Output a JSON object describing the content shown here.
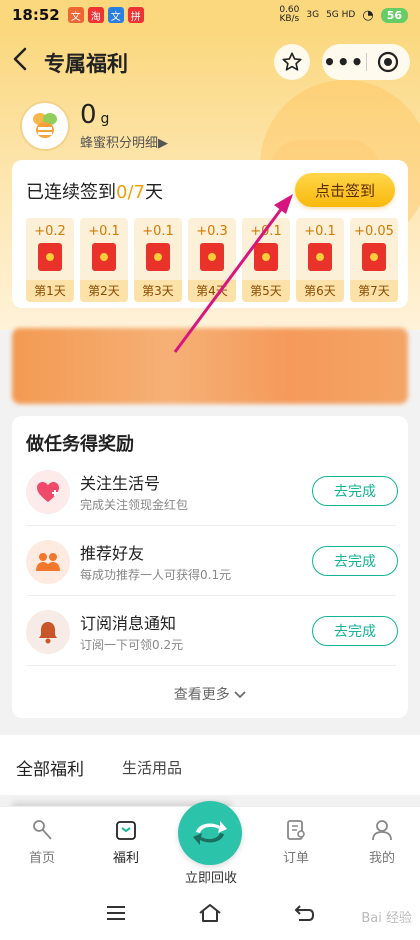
{
  "status": {
    "time": "18:52",
    "apps": [
      "文",
      "淘",
      "文",
      "拼"
    ],
    "net_speed": "0.60\nKB/s",
    "signal1": "3G",
    "signal2": "5G HD",
    "battery": "56"
  },
  "nav": {
    "title": "专属福利"
  },
  "points": {
    "value": "0",
    "unit": "g",
    "detail_link": "蜂蜜积分明细▶"
  },
  "checkin": {
    "prefix": "已连续签到",
    "count": "0/7",
    "suffix": "天",
    "button": "点击签到",
    "days": [
      {
        "amount": "+0.2",
        "label": "第1天"
      },
      {
        "amount": "+0.1",
        "label": "第2天"
      },
      {
        "amount": "+0.1",
        "label": "第3天"
      },
      {
        "amount": "+0.3",
        "label": "第4天"
      },
      {
        "amount": "+0.1",
        "label": "第5天"
      },
      {
        "amount": "+0.1",
        "label": "第6天"
      },
      {
        "amount": "+0.05",
        "label": "第7天"
      }
    ]
  },
  "tasks": {
    "heading": "做任务得奖励",
    "items": [
      {
        "name": "关注生活号",
        "desc": "完成关注领现金红包",
        "button": "去完成",
        "icon": "heart-icon"
      },
      {
        "name": "推荐好友",
        "desc": "每成功推荐一人可获得0.1元",
        "button": "去完成",
        "icon": "people-icon"
      },
      {
        "name": "订阅消息通知",
        "desc": "订阅一下可领0.2元",
        "button": "去完成",
        "icon": "bell-icon"
      }
    ],
    "see_more": "查看更多"
  },
  "categories": {
    "all": "全部福利",
    "life": "生活用品"
  },
  "tabbar": {
    "home": "首页",
    "welfare": "福利",
    "recycle": "立即回收",
    "orders": "订单",
    "mine": "我的"
  },
  "watermark": "Bai 经验",
  "colors": {
    "accent": "#f9b90c",
    "primary_green": "#14b597",
    "red_packet": "#e8322a"
  }
}
